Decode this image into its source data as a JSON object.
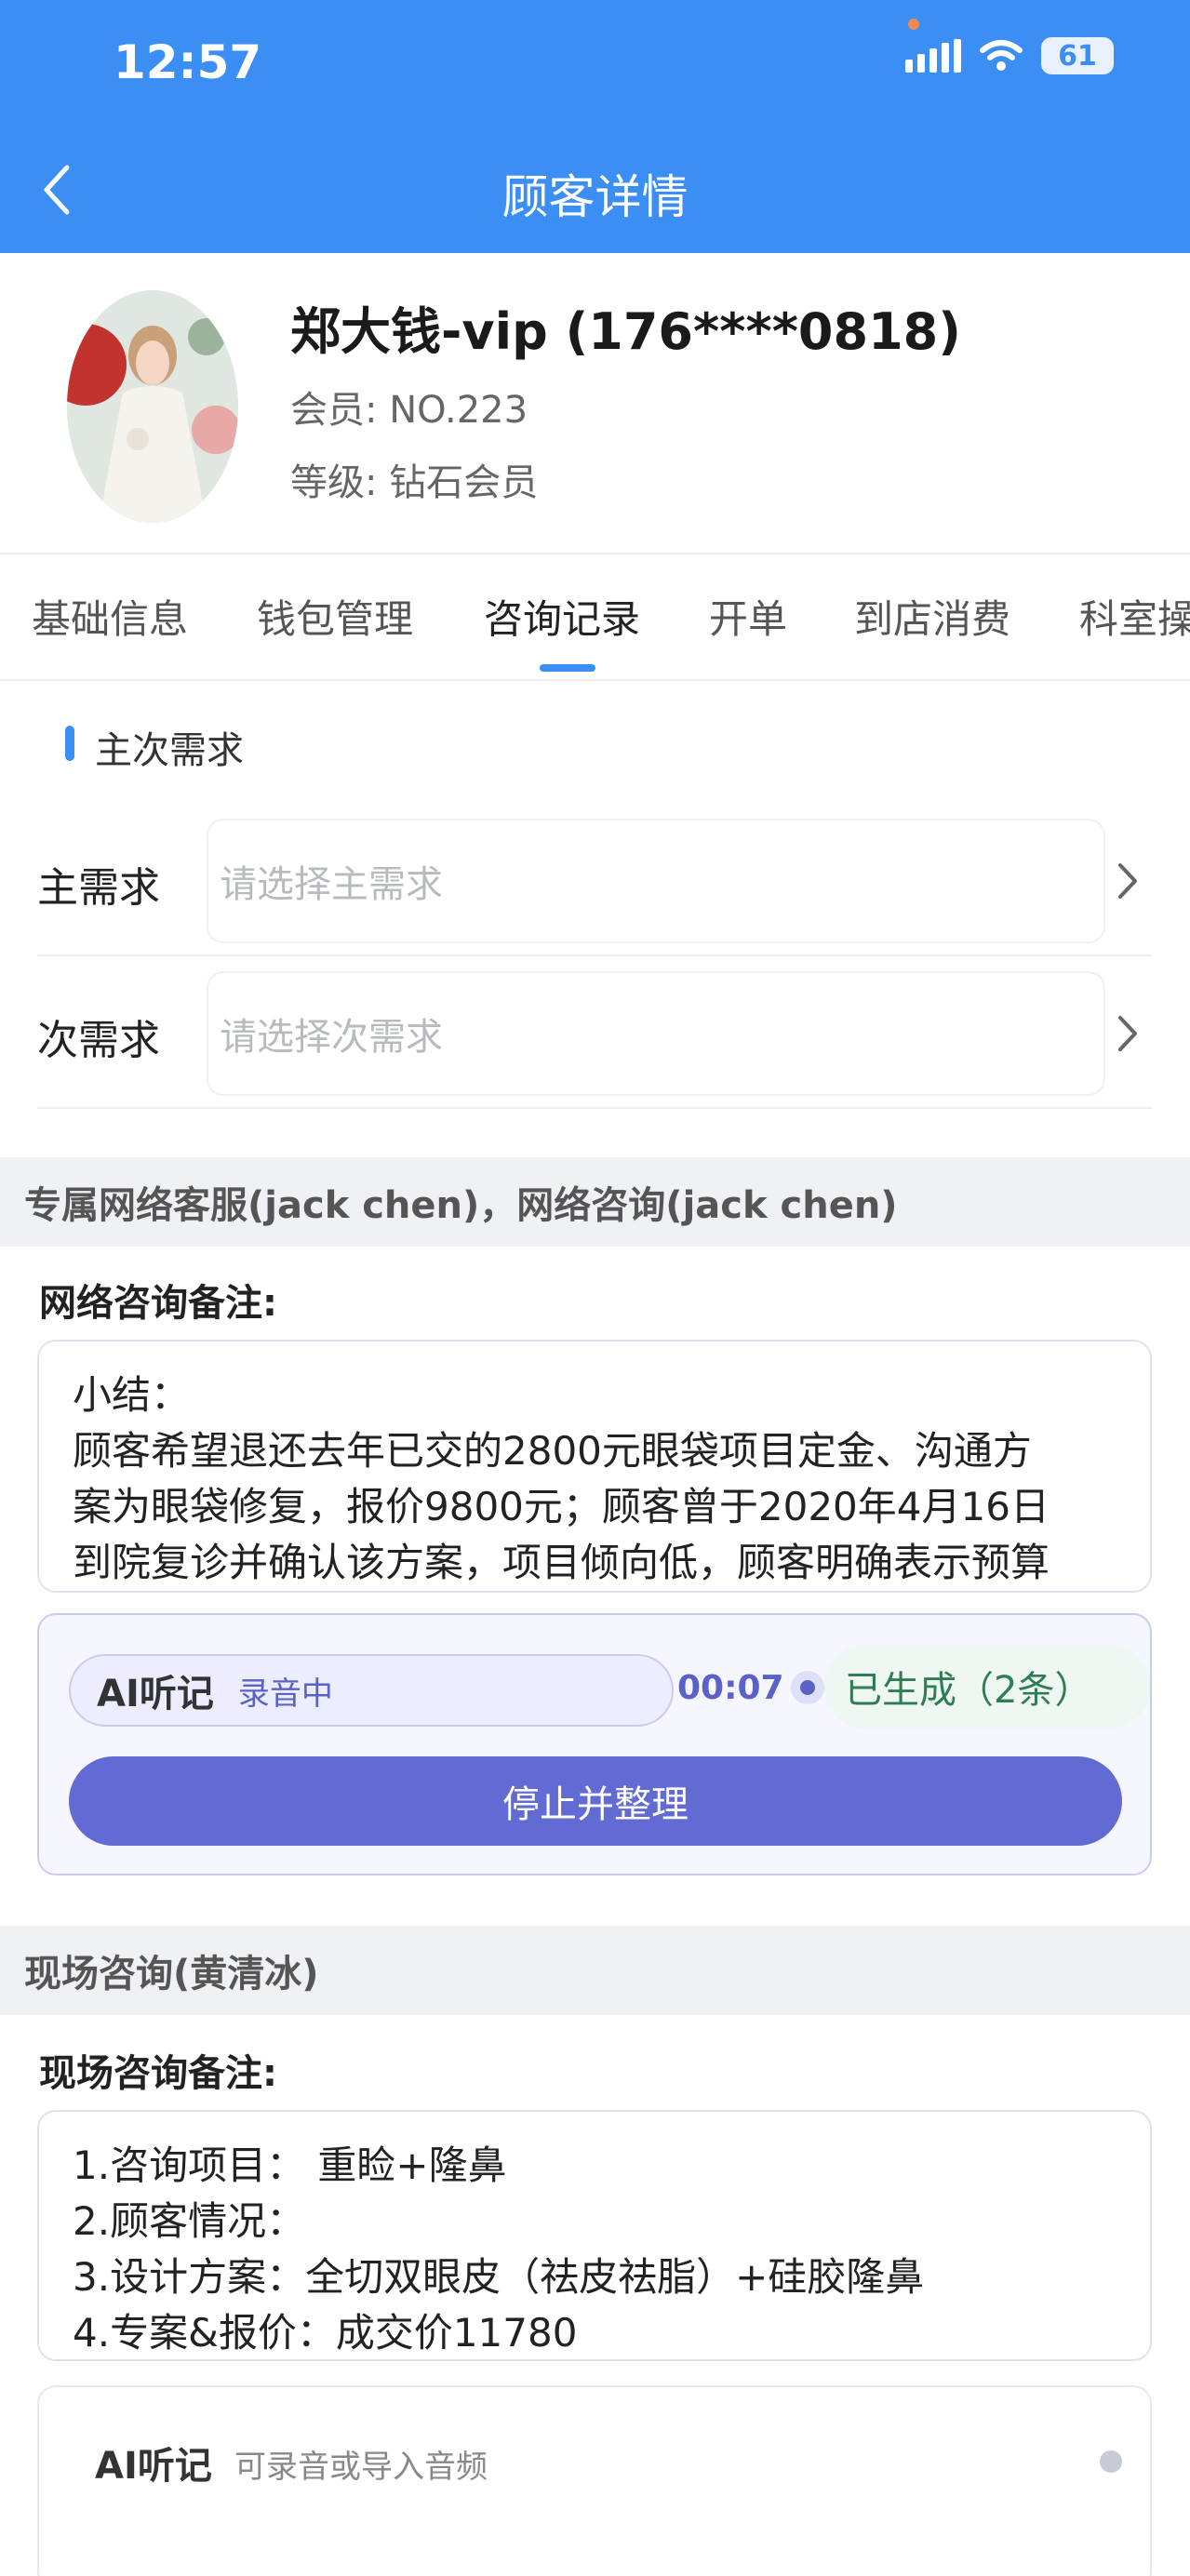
{
  "status_bar": {
    "time": "12:57",
    "battery": "61"
  },
  "nav": {
    "title": "顾客详情"
  },
  "profile": {
    "name": "郑大钱-vip (176****0818)",
    "member_no": "会员: NO.223",
    "level": "等级: 钻石会员"
  },
  "tabs": [
    {
      "label": "基础信息"
    },
    {
      "label": "钱包管理"
    },
    {
      "label": "咨询记录",
      "active": true
    },
    {
      "label": "开单"
    },
    {
      "label": "到店消费"
    },
    {
      "label": "科室操"
    }
  ],
  "demand": {
    "section_title": "主次需求",
    "primary": {
      "label": "主需求",
      "placeholder": "请选择主需求"
    },
    "secondary": {
      "label": "次需求",
      "placeholder": "请选择次需求"
    }
  },
  "online": {
    "header": "专属网络客服(jack chen)，网络咨询(jack chen)",
    "note_label": "网络咨询备注:",
    "note_lines": [
      "小结：",
      "顾客希望退还去年已交的2800元眼袋项目定金、沟通方",
      "案为眼袋修复，报价9800元；顾客曾于2020年4月16日",
      "到院复诊并确认该方案，项目倾向低，顾客明确表示预算"
    ]
  },
  "ai_recorder": {
    "title": "AI听记",
    "status": "录音中",
    "timer": "00:07",
    "generated": "已生成（2条）",
    "stop_button": "停止并整理"
  },
  "onsite": {
    "header": "现场咨询(黄清冰)",
    "note_label": "现场咨询备注:",
    "note_lines": [
      "1.咨询项目： 重睑+隆鼻",
      "2.顾客情况：",
      "3.设计方案：全切双眼皮（祛皮祛脂）+硅胶隆鼻",
      "4.专案&报价：成交价11780"
    ]
  },
  "ai_card": {
    "title": "AI听记",
    "hint": "可录音或导入音频"
  },
  "colors": {
    "primary": "#3b8ef4",
    "ai_accent": "#626ad3",
    "success": "#2f7d55"
  }
}
